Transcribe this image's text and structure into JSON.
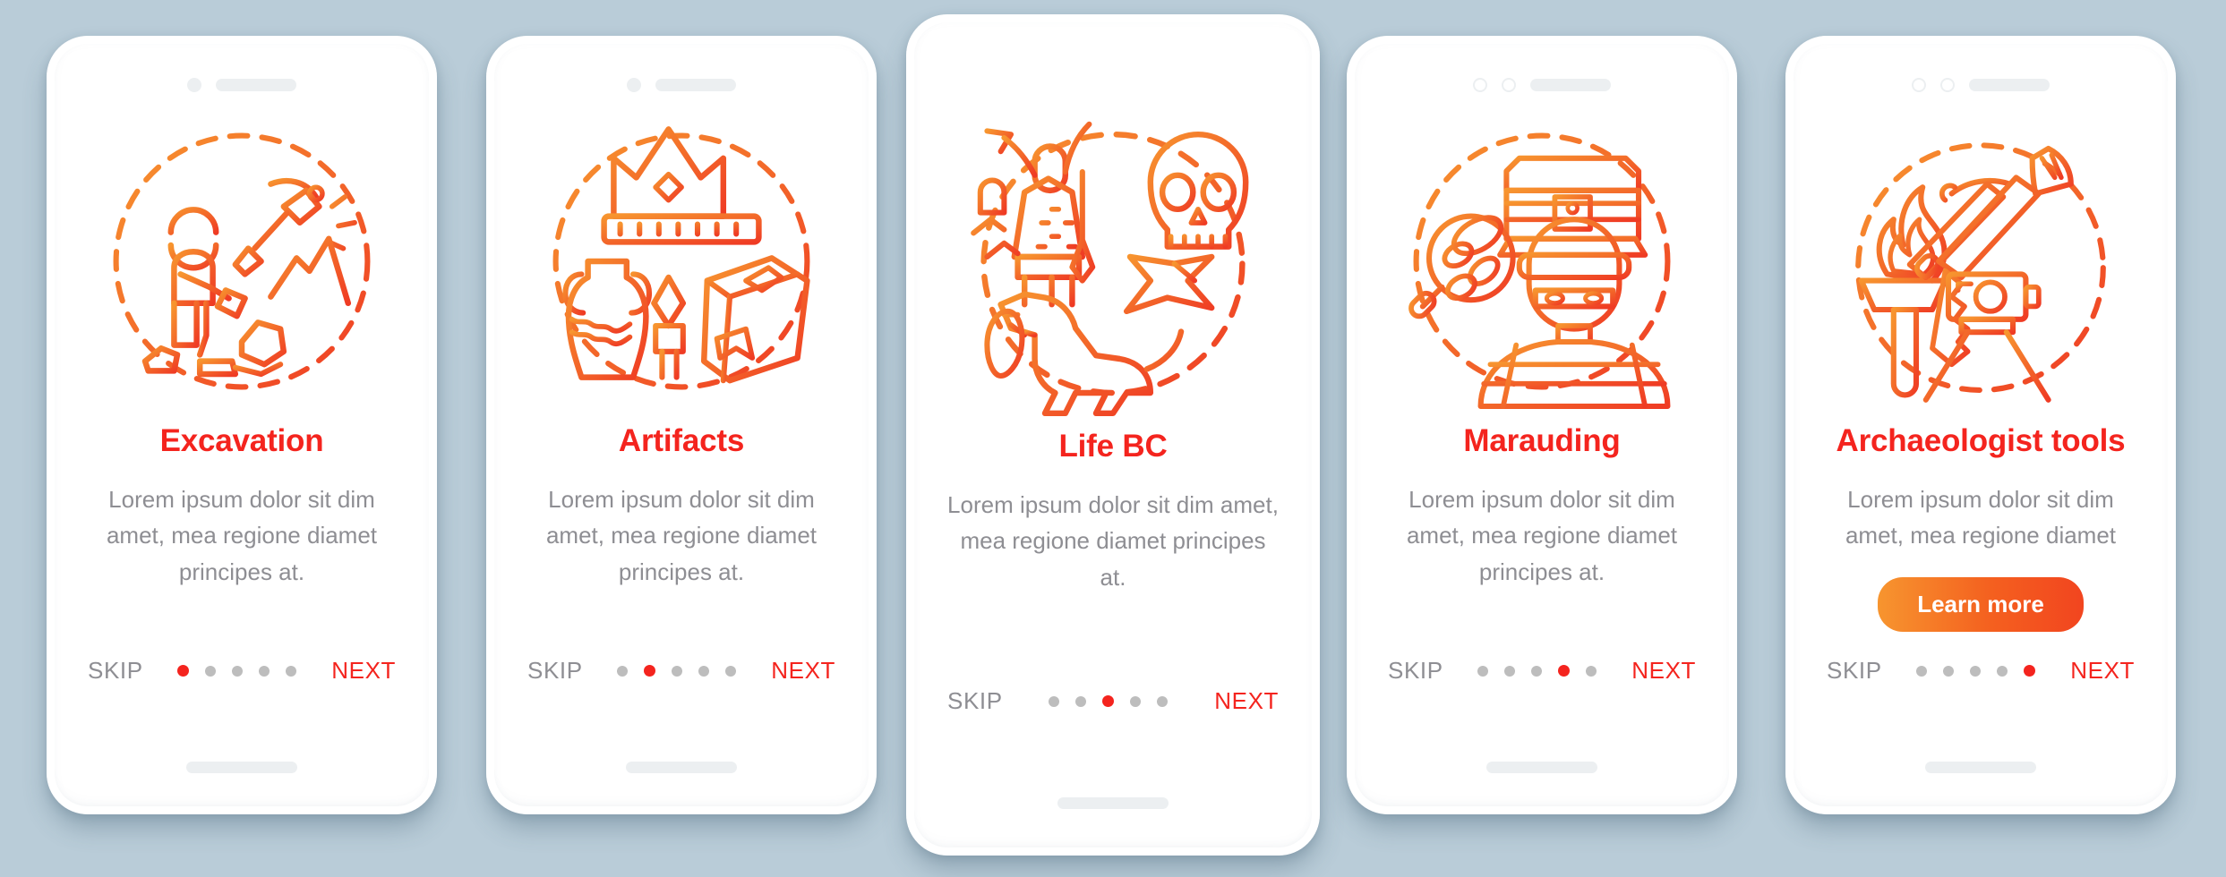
{
  "background_color": "#b9ccd8",
  "theme": {
    "title_color": "#f4241e",
    "body_color": "#8e8e93",
    "accent_gradient_from": "#f7952f",
    "accent_gradient_to": "#f2451f",
    "icon_color_start": "#f7952f",
    "icon_color_end": "#ef3b24",
    "dot_inactive_color": "#bdbdbd",
    "dot_active_color": "#f4241e"
  },
  "shared": {
    "skip_label": "SKIP",
    "next_label": "NEXT",
    "body_text": "Lorem ipsum dolor sit dim amet, mea regione diamet principes at.",
    "body_text_short": "Lorem ipsum dolor sit dim amet, mea regione diamet",
    "dot_count": 5
  },
  "screens": [
    {
      "id": "excavation",
      "title": "Excavation",
      "body": "Lorem ipsum dolor sit dim amet, mea regione diamet principes at.",
      "active_dot": 1,
      "skip_label": "SKIP",
      "next_label": "NEXT",
      "icon_name": "excavation-icon",
      "icon_elements": [
        "archaeologist-kneeling",
        "pickaxe",
        "rocks",
        "dashed-circle"
      ],
      "status_bar": {
        "camera_dots": 1,
        "camera_style": "filled",
        "speaker": true
      },
      "has_learn_more": false,
      "elevated": false
    },
    {
      "id": "artifacts",
      "title": "Artifacts",
      "body": "Lorem ipsum dolor sit dim amet, mea regione diamet principes at.",
      "active_dot": 2,
      "skip_label": "SKIP",
      "next_label": "NEXT",
      "icon_name": "artifacts-icon",
      "icon_elements": [
        "crown",
        "amphora-vase",
        "arrowhead",
        "ancient-book",
        "dashed-circle"
      ],
      "status_bar": {
        "camera_dots": 1,
        "camera_style": "filled",
        "speaker": true
      },
      "has_learn_more": false,
      "elevated": false
    },
    {
      "id": "life-bc",
      "title": "Life BC",
      "body": "Lorem ipsum dolor sit dim amet, mea regione diamet principes at.",
      "active_dot": 3,
      "skip_label": "SKIP",
      "next_label": "NEXT",
      "icon_name": "life-bc-icon",
      "icon_elements": [
        "caveman-with-spear",
        "skull",
        "stone-star",
        "dinosaur",
        "fern",
        "dashed-circle"
      ],
      "status_bar": {
        "camera_dots": 0,
        "camera_style": "none",
        "speaker": false
      },
      "has_learn_more": false,
      "elevated": true
    },
    {
      "id": "marauding",
      "title": "Marauding",
      "body": "Lorem ipsum dolor sit dim amet, mea regione diamet principes at.",
      "active_dot": 4,
      "skip_label": "SKIP",
      "next_label": "NEXT",
      "icon_name": "marauding-icon",
      "icon_elements": [
        "treasure-chest",
        "magnifier-with-coins",
        "masked-thief",
        "dashed-circle"
      ],
      "status_bar": {
        "camera_dots": 2,
        "camera_style": "outline",
        "speaker": true
      },
      "has_learn_more": false,
      "elevated": false
    },
    {
      "id": "archaeologist-tools",
      "title": "Archaeologist tools",
      "body": "Lorem ipsum dolor sit dim amet, mea regione diamet",
      "active_dot": 5,
      "skip_label": "SKIP",
      "next_label": "NEXT",
      "learn_more_label": "Learn more",
      "icon_name": "archaeologist-tools-icon",
      "icon_elements": [
        "torch-flame",
        "crossed-pickaxe-and-brush",
        "camera-tripod",
        "dashed-circle"
      ],
      "status_bar": {
        "camera_dots": 2,
        "camera_style": "outline",
        "speaker": true
      },
      "has_learn_more": true,
      "elevated": false
    }
  ]
}
